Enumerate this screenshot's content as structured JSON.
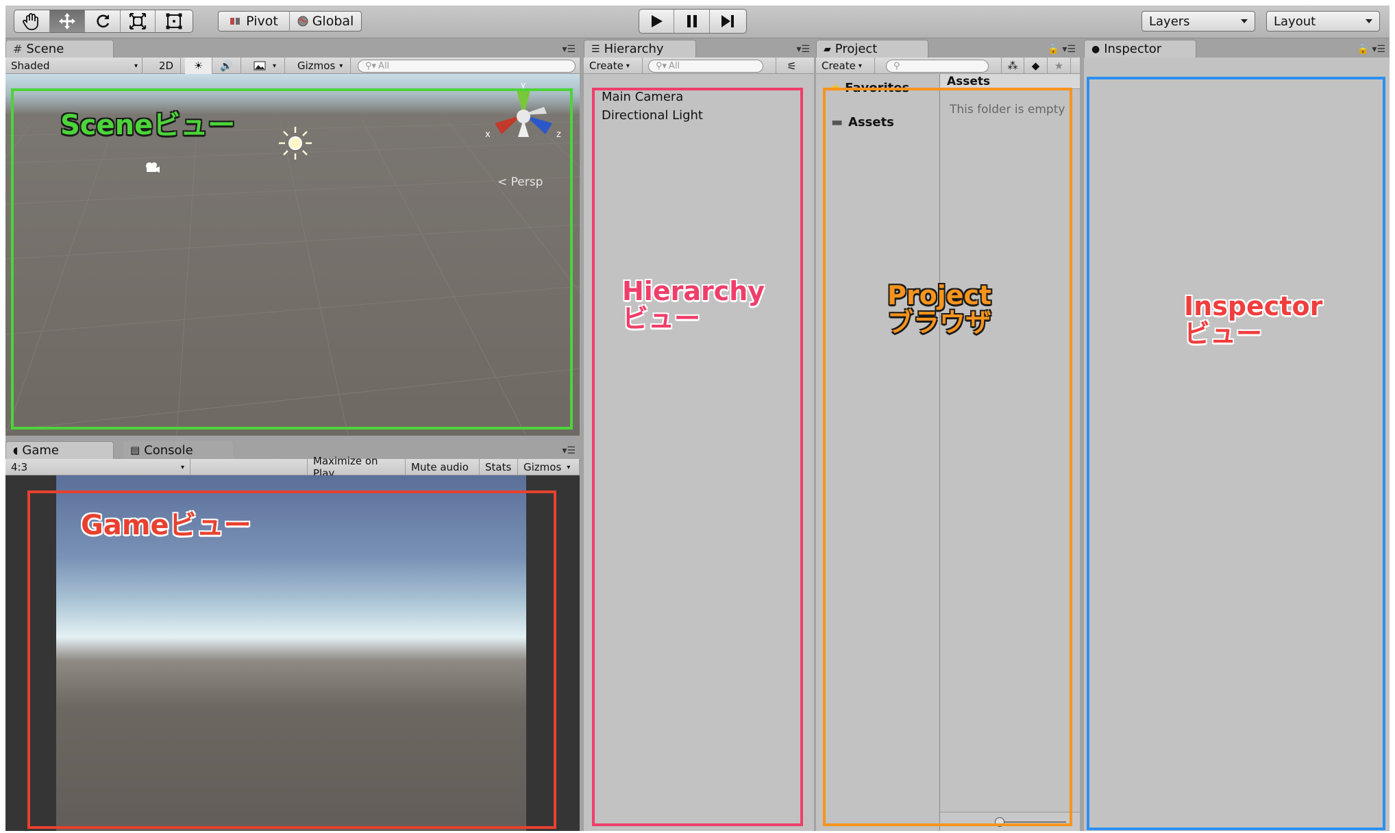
{
  "toolbar": {
    "pivot_label": "Pivot",
    "global_label": "Global",
    "layers_label": "Layers",
    "layout_label": "Layout",
    "tool_icons": [
      "hand-icon",
      "move-icon",
      "rotate-icon",
      "scale-icon",
      "rect-icon"
    ],
    "play_icons": [
      "play-icon",
      "pause-icon",
      "step-icon"
    ]
  },
  "scene": {
    "tab_label": "Scene",
    "shading_mode": "Shaded",
    "mode_2d_label": "2D",
    "gizmos_label": "Gizmos",
    "search_placeholder": "All",
    "persp_label": "Persp",
    "axis_y": "y",
    "axis_x": "x",
    "axis_z": "z"
  },
  "game": {
    "tab_label": "Game",
    "console_tab_label": "Console",
    "aspect_label": "4:3",
    "maximize_label": "Maximize on Play",
    "mute_label": "Mute audio",
    "stats_label": "Stats",
    "gizmos_label": "Gizmos"
  },
  "hierarchy": {
    "tab_label": "Hierarchy",
    "create_label": "Create",
    "search_placeholder": "All",
    "items": [
      "Main Camera",
      "Directional Light"
    ]
  },
  "project": {
    "tab_label": "Project",
    "create_label": "Create",
    "favorites_label": "Favorites",
    "assets_tree_label": "Assets",
    "assets_header": "Assets",
    "empty_message": "This folder is empty"
  },
  "inspector": {
    "tab_label": "Inspector"
  },
  "annotations": {
    "scene": "Sceneビュー",
    "game": "Gameビュー",
    "hierarchy": [
      "Hierarchy",
      "ビュー"
    ],
    "project": [
      "Project",
      "ブラウザ"
    ],
    "inspector": [
      "Inspector",
      "ビュー"
    ]
  },
  "colors": {
    "scene_box": "#4cd43a",
    "game_box": "#e8412e",
    "hierarchy_box": "#ef3e6a",
    "project_box": "#f7941d",
    "inspector_box": "#2d8ff0"
  }
}
